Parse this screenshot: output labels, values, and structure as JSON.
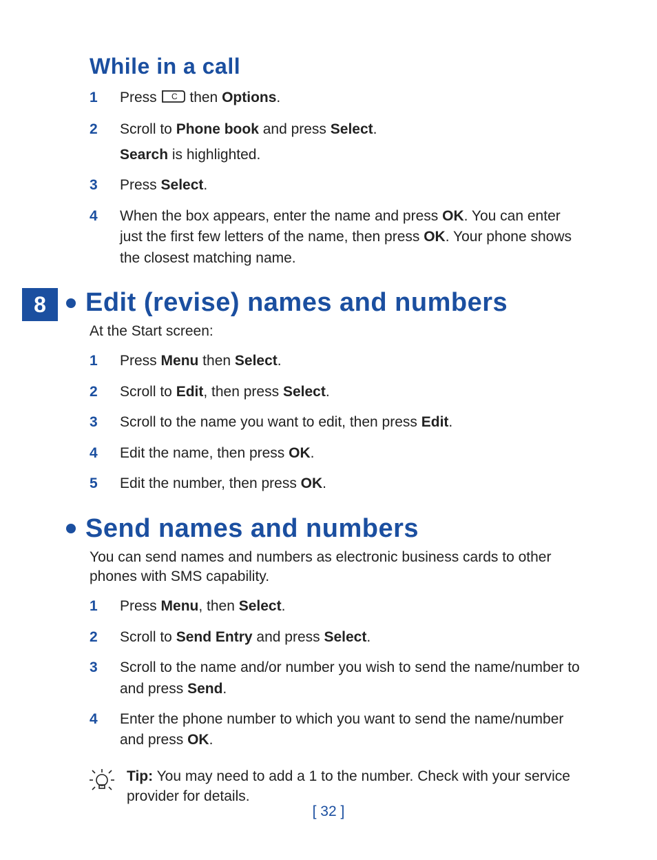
{
  "chapterNumber": "8",
  "pageNumber": "[ 32 ]",
  "section1": {
    "title": "While in a call",
    "steps": [
      {
        "num": "1",
        "pre": "Press ",
        "postKey": " then ",
        "b1": "Options",
        "tail": "."
      },
      {
        "num": "2",
        "t1": "Scroll to ",
        "b1": "Phone book",
        "t2": " and press ",
        "b2": "Select",
        "t3": ".",
        "subB": "Search",
        "subT": " is highlighted."
      },
      {
        "num": "3",
        "t1": "Press ",
        "b1": "Select",
        "t2": "."
      },
      {
        "num": "4",
        "t1": "When the box appears, enter the name and press ",
        "b1": "OK",
        "t2": ". You can enter just the first few letters of the name, then press ",
        "b2": "OK",
        "t3": ". Your phone shows the closest matching name."
      }
    ]
  },
  "section2": {
    "title": "Edit (revise) names and numbers",
    "intro": "At the Start screen:",
    "steps": [
      {
        "num": "1",
        "t1": "Press ",
        "b1": "Menu",
        "t2": " then ",
        "b2": "Select",
        "t3": "."
      },
      {
        "num": "2",
        "t1": "Scroll to ",
        "b1": "Edit",
        "t2": ", then press ",
        "b2": "Select",
        "t3": "."
      },
      {
        "num": "3",
        "t1": "Scroll to the name you want to edit, then press ",
        "b1": "Edit",
        "t2": "."
      },
      {
        "num": "4",
        "t1": "Edit the name, then press ",
        "b1": "OK",
        "t2": "."
      },
      {
        "num": "5",
        "t1": "Edit the number, then press ",
        "b1": "OK",
        "t2": "."
      }
    ]
  },
  "section3": {
    "title": "Send names and numbers",
    "intro": "You can send names and numbers as electronic business cards to other phones with SMS capability.",
    "steps": [
      {
        "num": "1",
        "t1": "Press ",
        "b1": "Menu",
        "t2": ", then ",
        "b2": "Select",
        "t3": "."
      },
      {
        "num": "2",
        "t1": "Scroll to ",
        "b1": "Send Entry",
        "t2": " and press ",
        "b2": "Select",
        "t3": "."
      },
      {
        "num": "3",
        "t1": "Scroll to the name and/or number you wish to send the name/number to and press ",
        "b1": "Send",
        "t2": "."
      },
      {
        "num": "4",
        "t1": "Enter the phone number to which you want to send the name/number and press ",
        "b1": "OK",
        "t2": "."
      }
    ],
    "tipLabel": "Tip:",
    "tipText": " You may need to add a 1 to the number. Check with your service provider for details."
  }
}
